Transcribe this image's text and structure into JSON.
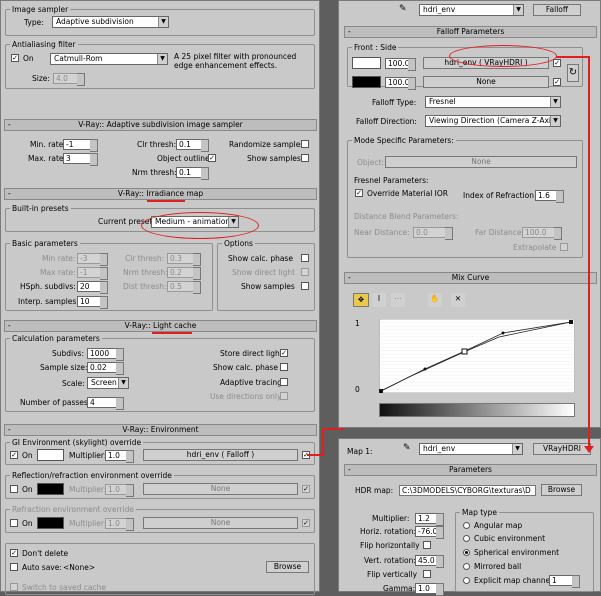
{
  "left": {
    "image_sampler": {
      "title": "Image sampler",
      "type_label": "Type:",
      "type_value": "Adaptive subdivision"
    },
    "antialiasing": {
      "title": "Antialiasing filter",
      "on_label": "On",
      "filter_value": "Catmull-Rom",
      "description": "A 25 pixel filter with pronounced edge enhancement effects.",
      "size_label": "Size:",
      "size_value": "4.0"
    },
    "adaptive": {
      "header": "V-Ray:: Adaptive subdivision image sampler",
      "min_rate_label": "Min. rate:",
      "min_rate": "-1",
      "max_rate_label": "Max. rate:",
      "max_rate": "3",
      "clr_thresh_label": "Clr thresh:",
      "clr_thresh": "0.1",
      "object_outline_label": "Object outline",
      "nrm_thresh_label": "Nrm thresh:",
      "nrm_thresh": "0.1",
      "randomize_label": "Randomize samples",
      "show_samples_label": "Show samples"
    },
    "irradiance": {
      "header_prefix": "V-Ray::",
      "header_name": "Irradiance map",
      "presets_title": "Built-in presets",
      "current_preset_label": "Current preset:",
      "current_preset": "Medium - animation",
      "basic_title": "Basic parameters",
      "min_rate_label": "Min rate:",
      "min_rate": "-3",
      "max_rate_label": "Max rate:",
      "max_rate": "-1",
      "hsph_label": "HSph. subdivs:",
      "hsph": "20",
      "interp_label": "Interp. samples:",
      "interp": "10",
      "clr_thresh_label": "Clr thresh:",
      "clr_thresh": "0.3",
      "nrm_thresh_label": "Nrm thresh:",
      "nrm_thresh": "0.2",
      "dist_thresh_label": "Dist thresh:",
      "dist_thresh": "0.5",
      "options_title": "Options",
      "show_calc_label": "Show calc. phase",
      "show_direct_label": "Show direct light",
      "show_samples_label": "Show samples"
    },
    "light_cache": {
      "header_prefix": "V-Ray::",
      "header_name": "Light cache",
      "calc_title": "Calculation parameters",
      "subdivs_label": "Subdivs:",
      "subdivs": "1000",
      "sample_size_label": "Sample size:",
      "sample_size": "0.02",
      "scale_label": "Scale:",
      "scale": "Screen",
      "passes_label": "Number of passes:",
      "passes": "4",
      "store_direct_label": "Store direct light",
      "show_calc_label": "Show calc. phase",
      "adaptive_tracing_label": "Adaptive tracing",
      "use_directions_label": "Use directions only"
    },
    "environment": {
      "header": "V-Ray:: Environment",
      "gi_title": "GI Environment (skylight) override",
      "on_label": "On",
      "multiplier_label": "Multiplier:",
      "gi_multiplier": "1.0",
      "gi_map": "hdri_env  ( Falloff )",
      "refl_title": "Reflection/refraction environment override",
      "refl_multiplier": "1.0",
      "refl_map": "None",
      "refr_title": "Refraction environment override",
      "refr_multiplier": "1.0",
      "refr_map": "None"
    },
    "bottom": {
      "dont_delete_label": "Don't delete",
      "auto_save_label": "Auto save:",
      "auto_save_value": "<None>",
      "browse_label": "Browse",
      "switch_label": "Switch to saved cache"
    }
  },
  "right_top": {
    "map_name": "hdri_env",
    "map_type": "Falloff",
    "falloff_header": "Falloff Parameters",
    "front_side_title": "Front : Side",
    "val1": "100.0",
    "map1": "hdri_env  ( VRayHDRI )",
    "val2": "100.0",
    "map2": "None",
    "falloff_type_label": "Falloff Type:",
    "falloff_type": "Fresnel",
    "falloff_dir_label": "Falloff Direction:",
    "falloff_dir": "Viewing Direction (Camera Z-Axis)",
    "mode_title": "Mode Specific Parameters:",
    "object_label": "Object:",
    "object_value": "None",
    "fresnel_title": "Fresnel Parameters:",
    "override_ior_label": "Override Material IOR",
    "ior_label": "Index of Refraction",
    "ior_value": "1.6",
    "distance_title": "Distance Blend Parameters:",
    "near_label": "Near Distance:",
    "near_value": "0.0",
    "far_label": "Far Distance:",
    "far_value": "100.0",
    "extrapolate_label": "Extrapolate",
    "mix_header": "Mix Curve",
    "curve_top": "1",
    "curve_bottom": "0"
  },
  "right_bottom": {
    "map_label": "Map 1:",
    "map_name": "hdri_env",
    "map_type": "VRayHDRI",
    "params_header": "Parameters",
    "hdr_label": "HDR map:",
    "hdr_path": "C:\\3DMODELS\\CYBORG\\texturas\\D",
    "browse_label": "Browse",
    "multiplier_label": "Multiplier:",
    "multiplier": "1.2",
    "horiz_label": "Horiz. rotation:",
    "horiz": "-76.0",
    "flip_h_label": "Flip horizontally",
    "vert_label": "Vert. rotation:",
    "vert": "45.0",
    "flip_v_label": "Flip vertically",
    "gamma_label": "Gamma:",
    "gamma": "1.0",
    "map_type_title": "Map type",
    "angular": "Angular map",
    "cubic": "Cubic environment",
    "spherical": "Spherical environment",
    "mirrored": "Mirrored ball",
    "explicit": "Explicit map channel",
    "explicit_value": "1"
  },
  "colors": {
    "annotation": "#e02020",
    "panel": "#c9c9c9"
  }
}
